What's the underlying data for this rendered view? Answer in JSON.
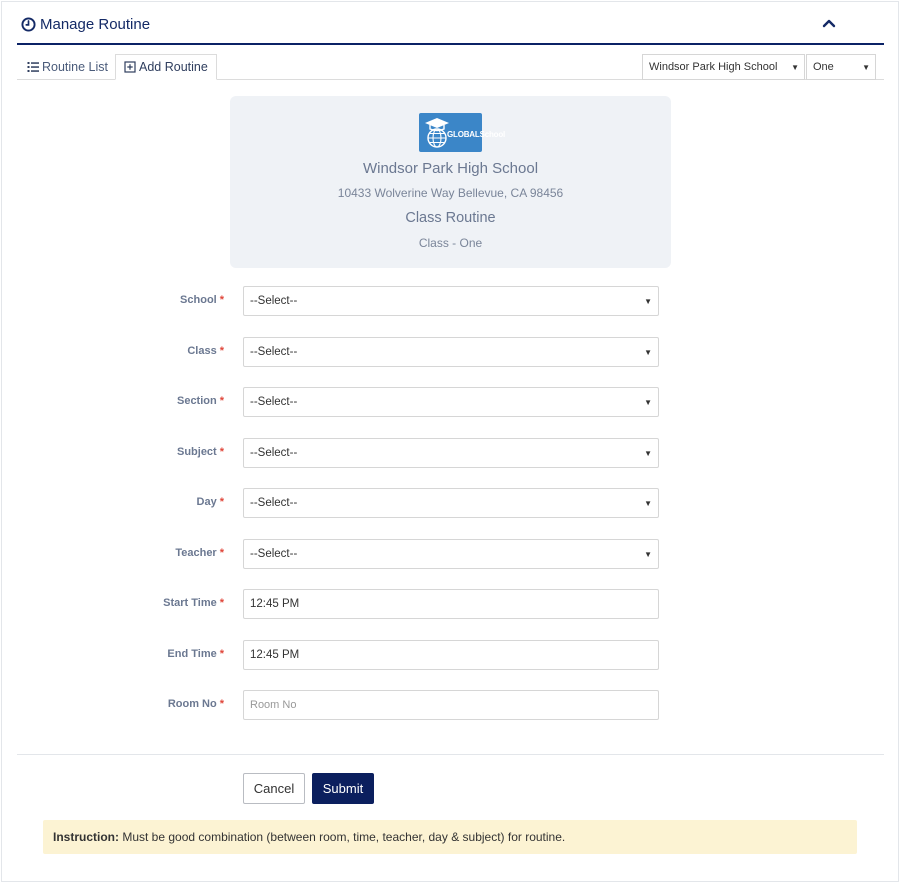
{
  "header": {
    "title": "Manage Routine",
    "title_icon": "clock-icon",
    "collapse_icon": "chevron-up-icon"
  },
  "tabs": [
    {
      "label": "Routine List",
      "icon": "list-icon",
      "active": false
    },
    {
      "label": "Add Routine",
      "icon": "plus-square-icon",
      "active": true
    }
  ],
  "filters": {
    "school": "Windsor Park High School",
    "class": "One"
  },
  "card": {
    "logo_text": "GLOBALSchool",
    "school_name": "Windsor Park High School",
    "address": "10433 Wolverine Way Bellevue, CA 98456",
    "routine_title": "Class Routine",
    "class_label": "Class - One"
  },
  "form": {
    "fields": [
      {
        "label": "School",
        "value": "--Select--",
        "type": "select"
      },
      {
        "label": "Class",
        "value": "--Select--",
        "type": "select"
      },
      {
        "label": "Section",
        "value": "--Select--",
        "type": "select"
      },
      {
        "label": "Subject",
        "value": "--Select--",
        "type": "select"
      },
      {
        "label": "Day",
        "value": "--Select--",
        "type": "select"
      },
      {
        "label": "Teacher",
        "value": "--Select--",
        "type": "select"
      },
      {
        "label": "Start Time",
        "value": "12:45 PM",
        "type": "input"
      },
      {
        "label": "End Time",
        "value": "12:45 PM",
        "type": "input"
      },
      {
        "label": "Room No",
        "value": "",
        "placeholder": "Room No",
        "type": "input"
      }
    ],
    "required_mark": "*"
  },
  "buttons": {
    "cancel": "Cancel",
    "submit": "Submit"
  },
  "instruction": {
    "label": "Instruction:",
    "text": "Must be good combination (between room, time, teacher, day & subject) for routine."
  },
  "colors": {
    "primary": "#0b1f5e",
    "required": "#e0463a",
    "card_bg": "#eff2f6",
    "instruction_bg": "#fcf3d3"
  }
}
